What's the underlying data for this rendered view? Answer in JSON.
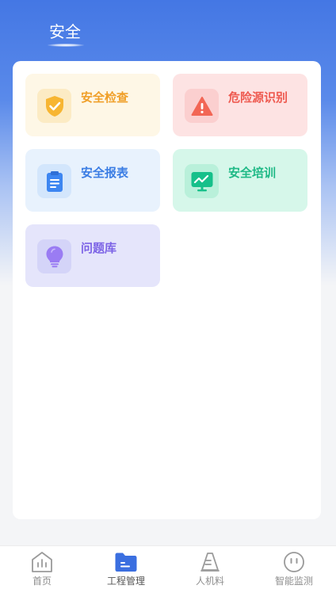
{
  "header": {
    "tab_title": "安全"
  },
  "cards": [
    {
      "label": "安全检查",
      "icon": "shield-check-icon",
      "bg": "#fef7e6",
      "icon_bg": "#fcebc4",
      "color": "#f0a02a"
    },
    {
      "label": "危险源识别",
      "icon": "warning-icon",
      "bg": "#fde3e3",
      "icon_bg": "#fbcfcf",
      "color": "#ee5a50"
    },
    {
      "label": "安全报表",
      "icon": "clipboard-icon",
      "bg": "#e8f2fd",
      "icon_bg": "#d3e6fc",
      "color": "#3b7de4"
    },
    {
      "label": "安全培训",
      "icon": "monitor-chart-icon",
      "bg": "#d6f7ea",
      "icon_bg": "#b9f0da",
      "color": "#1fb986"
    },
    {
      "label": "问题库",
      "icon": "lightbulb-icon",
      "bg": "#e5e5fb",
      "icon_bg": "#d4d4f8",
      "color": "#7c63e6"
    }
  ],
  "bottom_nav": {
    "items": [
      {
        "label": "首页",
        "icon": "home-chart-icon",
        "active": false
      },
      {
        "label": "工程管理",
        "icon": "folder-icon",
        "active": true
      },
      {
        "label": "人机料",
        "icon": "cone-icon",
        "active": false
      },
      {
        "label": "智能监测",
        "icon": "smiley-monitor-icon",
        "active": false
      }
    ]
  },
  "colors": {
    "brand_blue": "#4477e4",
    "nav_active": "#3b6fe0",
    "nav_inactive": "#9a9a9a"
  }
}
